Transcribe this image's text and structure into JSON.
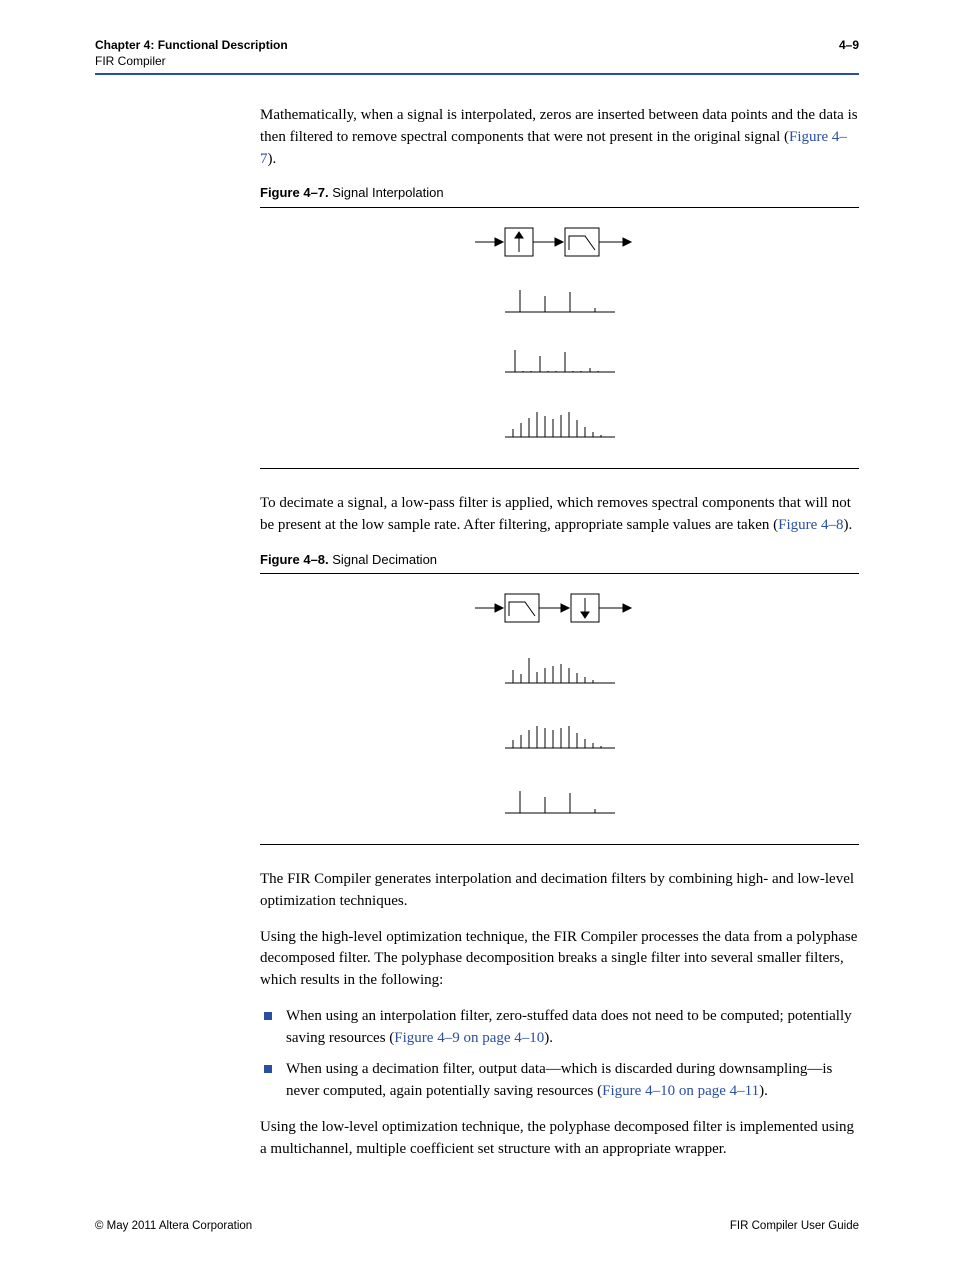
{
  "header": {
    "chapter_label": "Chapter 4:",
    "chapter_title": "Functional Description",
    "section": "FIR Compiler",
    "page_number": "4–9"
  },
  "body": {
    "p1_a": "Mathematically, when a signal is interpolated, zeros are inserted between data points and the data is then filtered to remove spectral components that were not present in the original signal (",
    "p1_link": "Figure 4–7",
    "p1_b": ").",
    "fig47_bold": "Figure 4–7.",
    "fig47_caption": " Signal Interpolation",
    "p2_a": "To decimate a signal, a low-pass filter is applied, which removes spectral components that will not be present at the low sample rate. After filtering, appropriate sample values are taken (",
    "p2_link": "Figure 4–8",
    "p2_b": ").",
    "fig48_bold": "Figure 4–8.",
    "fig48_caption": " Signal Decimation",
    "p3": "The FIR Compiler generates interpolation and decimation filters by combining high- and low-level optimization techniques.",
    "p4": "Using the high-level optimization technique, the FIR Compiler processes the data from a polyphase decomposed filter. The polyphase decomposition breaks a single filter into several smaller filters, which results in the following:",
    "li1_a": "When using an interpolation filter, zero-stuffed data does not need to be computed; potentially saving resources (",
    "li1_link": "Figure 4–9 on page 4–10",
    "li1_b": ").",
    "li2_a": "When using a decimation filter, output data—which is discarded during downsampling—is never computed, again potentially saving resources (",
    "li2_link": "Figure 4–10 on page 4–11",
    "li2_b": ").",
    "p5": "Using the low-level optimization technique, the polyphase decomposed filter is implemented using a multichannel, multiple coefficient set structure with an appropriate wrapper."
  },
  "footer": {
    "left": "© May 2011   Altera Corporation",
    "right": "FIR Compiler User Guide"
  },
  "chart_data": [
    {
      "type": "diagram",
      "id": "figure-4-7",
      "title": "Signal Interpolation",
      "blocks": [
        "input-arrow",
        "upsample-box(↑)",
        "arrow",
        "lowpass-box",
        "output-arrow"
      ],
      "signals": [
        {
          "name": "input-sparse",
          "stems": [
            20,
            14,
            18,
            3
          ]
        },
        {
          "name": "zero-stuffed",
          "stems": [
            20,
            0,
            0,
            14,
            0,
            0,
            18,
            0,
            0,
            3,
            0
          ]
        },
        {
          "name": "interpolated",
          "stems": [
            8,
            12,
            16,
            20,
            18,
            16,
            18,
            20,
            16,
            10,
            6,
            3
          ]
        }
      ]
    },
    {
      "type": "diagram",
      "id": "figure-4-8",
      "title": "Signal Decimation",
      "blocks": [
        "input-arrow",
        "lowpass-box",
        "arrow",
        "downsample-box(↓)",
        "output-arrow"
      ],
      "signals": [
        {
          "name": "input-dense",
          "stems": [
            12,
            8,
            20,
            10,
            14,
            16,
            18,
            14,
            10,
            6,
            3
          ]
        },
        {
          "name": "filtered",
          "stems": [
            8,
            12,
            16,
            20,
            18,
            16,
            18,
            20,
            16,
            10,
            6,
            3
          ]
        },
        {
          "name": "decimated",
          "stems": [
            20,
            14,
            18,
            3
          ]
        }
      ]
    }
  ]
}
